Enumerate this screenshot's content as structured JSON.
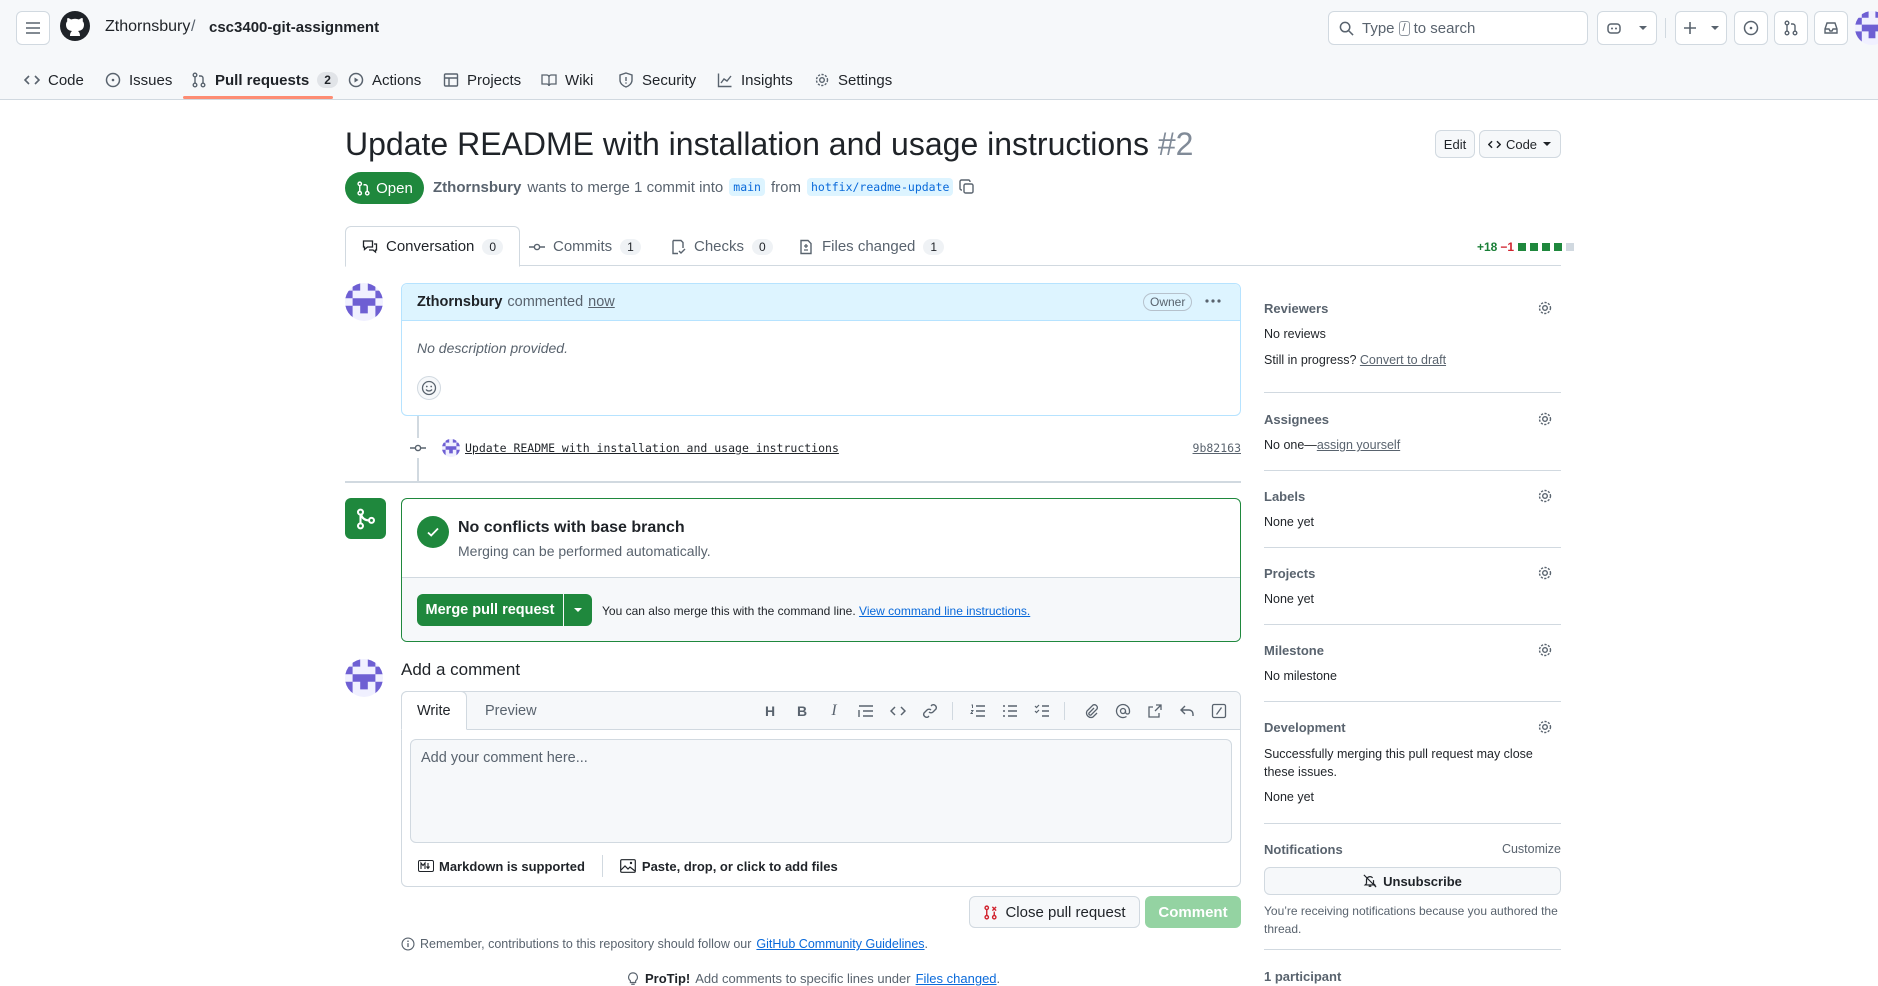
{
  "header": {
    "owner": "Zthornsbury",
    "separator": "/",
    "repo": "csc3400-git-assignment",
    "search_type": "Type",
    "search_key": "/",
    "search_suffix": "to search"
  },
  "repo_nav": [
    {
      "label": "Code",
      "icon": "code-icon"
    },
    {
      "label": "Issues",
      "icon": "issue-opened-icon"
    },
    {
      "label": "Pull requests",
      "icon": "git-pull-request-icon",
      "count": "2",
      "active": true
    },
    {
      "label": "Actions",
      "icon": "play-icon"
    },
    {
      "label": "Projects",
      "icon": "table-icon"
    },
    {
      "label": "Wiki",
      "icon": "book-icon"
    },
    {
      "label": "Security",
      "icon": "shield-icon"
    },
    {
      "label": "Insights",
      "icon": "graph-icon"
    },
    {
      "label": "Settings",
      "icon": "gear-icon"
    }
  ],
  "pr": {
    "title": "Update README with installation and usage instructions",
    "number": "#2",
    "edit_label": "Edit",
    "code_label": "Code",
    "state": "Open",
    "author": "Zthornsbury",
    "merge_text_1": "wants to merge 1 commit into",
    "base_branch": "main",
    "from_text": "from",
    "head_branch": "hotfix/readme-update"
  },
  "tabs": [
    {
      "label": "Conversation",
      "count": "0",
      "icon": "comment-discussion-icon"
    },
    {
      "label": "Commits",
      "count": "1",
      "icon": "git-commit-icon"
    },
    {
      "label": "Checks",
      "count": "0",
      "icon": "checklist-icon"
    },
    {
      "label": "Files changed",
      "count": "1",
      "icon": "file-diff-icon"
    }
  ],
  "diffstat": {
    "additions": "+18",
    "deletions": "−1"
  },
  "comment": {
    "author": "Zthornsbury",
    "action": "commented",
    "time": "now",
    "role": "Owner",
    "body": "No description provided."
  },
  "commit": {
    "message": "Update README with installation and usage instructions",
    "sha": "9b82163"
  },
  "merge": {
    "title": "No conflicts with base branch",
    "subtitle": "Merging can be performed automatically.",
    "button": "Merge pull request",
    "cli_text": "You can also merge this with the command line.",
    "cli_link": "View command line instructions."
  },
  "add_comment": {
    "title": "Add a comment",
    "tab_write": "Write",
    "tab_preview": "Preview",
    "placeholder": "Add your comment here...",
    "markdown": "Markdown is supported",
    "attach": "Paste, drop, or click to add files",
    "close_button": "Close pull request",
    "comment_button": "Comment",
    "remember_prefix": "Remember, contributions to this repository should follow our",
    "guidelines_link": "GitHub Community Guidelines",
    "remember_suffix": ".",
    "protip_label": "ProTip!",
    "protip_text": "Add comments to specific lines under",
    "protip_link": "Files changed",
    "protip_suffix": "."
  },
  "sidebar": {
    "reviewers": {
      "heading": "Reviewers",
      "value": "No reviews",
      "progress": "Still in progress?",
      "draft_link": "Convert to draft"
    },
    "assignees": {
      "heading": "Assignees",
      "value_prefix": "No one—",
      "value_link": "assign yourself"
    },
    "labels": {
      "heading": "Labels",
      "value": "None yet"
    },
    "projects": {
      "heading": "Projects",
      "value": "None yet"
    },
    "milestone": {
      "heading": "Milestone",
      "value": "No milestone"
    },
    "development": {
      "heading": "Development",
      "desc": "Successfully merging this pull request may close these issues.",
      "value": "None yet"
    },
    "notifications": {
      "heading": "Notifications",
      "customize": "Customize",
      "unsubscribe": "Unsubscribe",
      "desc": "You’re receiving notifications because you authored the thread."
    },
    "participants": "1 participant"
  },
  "colors": {
    "primary_green": "#1f883d",
    "link_blue": "#0969da",
    "accent_orange": "#fd8c73"
  }
}
